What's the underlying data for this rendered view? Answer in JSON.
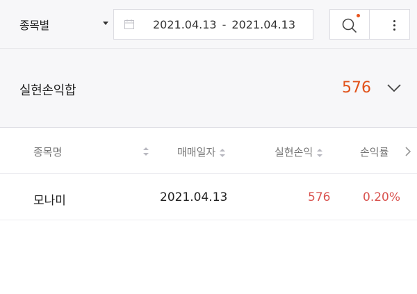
{
  "filter": {
    "type_label": "종목별",
    "date_start": "2021.04.13",
    "date_separator": "-",
    "date_end": "2021.04.13"
  },
  "summary": {
    "title": "실현손익합",
    "value": "576"
  },
  "table": {
    "columns": [
      "종목명",
      "매매일자",
      "실현손익",
      "손익률"
    ],
    "rows": [
      {
        "name": "모나미",
        "date": "2021.04.13",
        "profit": "576",
        "rate": "0.20%"
      }
    ]
  },
  "colors": {
    "accent_orange": "#e1521a",
    "profit_red": "#d9534f"
  }
}
